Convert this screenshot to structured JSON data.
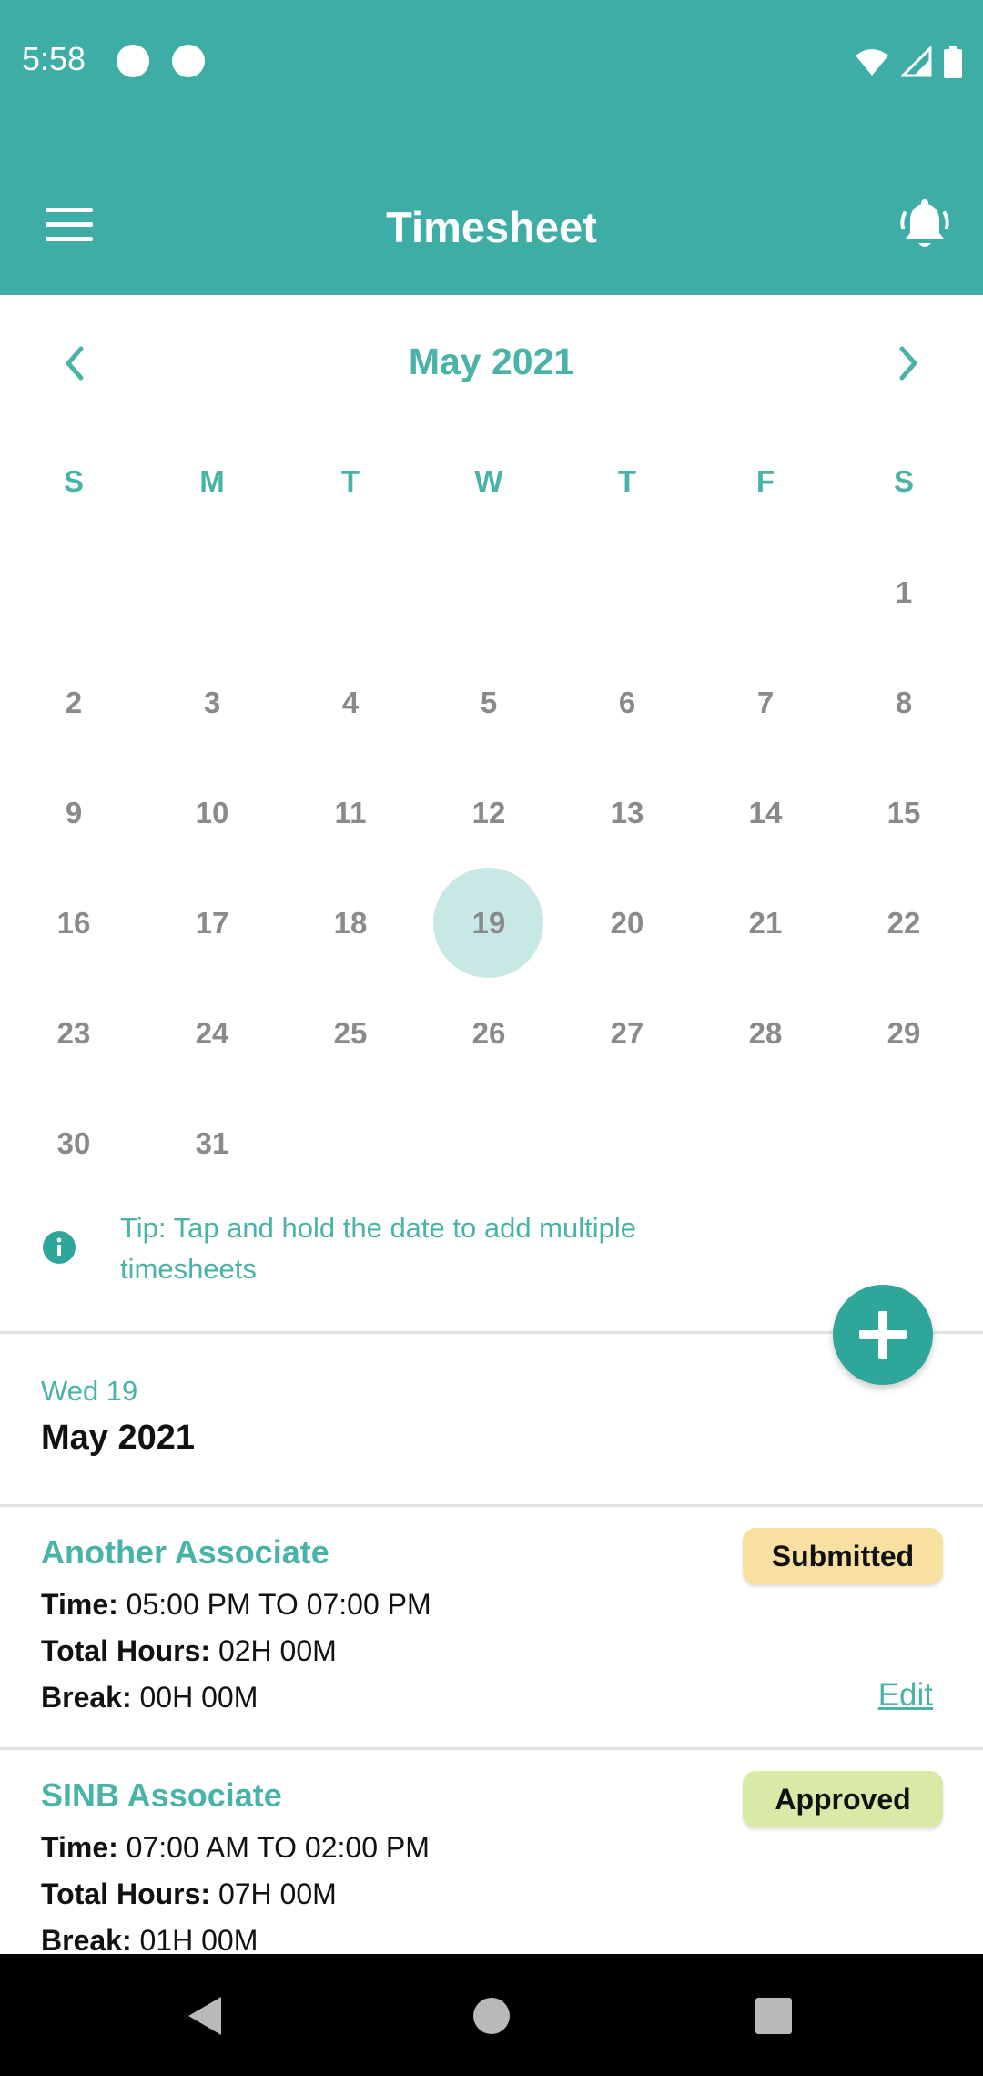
{
  "status_bar": {
    "time": "5:58",
    "icons": [
      "notification-dot-icon",
      "notification-dot-icon",
      "wifi-icon",
      "signal-icon",
      "battery-icon"
    ]
  },
  "app_bar": {
    "title": "Timesheet",
    "menu_icon": "hamburger-menu-icon",
    "bell_icon": "notification-bell-icon"
  },
  "calendar": {
    "month_label": "May 2021",
    "prev_icon": "chevron-left-icon",
    "next_icon": "chevron-right-icon",
    "weekdays": [
      "S",
      "M",
      "T",
      "W",
      "T",
      "F",
      "S"
    ],
    "days": [
      "1",
      "2",
      "3",
      "4",
      "5",
      "6",
      "7",
      "8",
      "9",
      "10",
      "11",
      "12",
      "13",
      "14",
      "15",
      "16",
      "17",
      "18",
      "19",
      "20",
      "21",
      "22",
      "23",
      "24",
      "25",
      "26",
      "27",
      "28",
      "29",
      "30",
      "31"
    ],
    "first_weekday_index": 6,
    "selected_day": "19"
  },
  "tip": {
    "icon": "info-icon",
    "text": "Tip: Tap and hold the date to add multiple timesheets"
  },
  "fab": {
    "icon": "plus-icon"
  },
  "selected_date": {
    "weekday_day": "Wed 19",
    "month_year": "May 2021"
  },
  "entries": [
    {
      "name": "Another Associate",
      "status": "Submitted",
      "status_color": "#f7e0a0",
      "time_label": "Time:",
      "time_value": "05:00 PM TO 07:00 PM",
      "hours_label": "Total Hours:",
      "hours_value": "02H 00M",
      "break_label": "Break:",
      "break_value": "00H 00M",
      "edit_label": "Edit"
    },
    {
      "name": "SINB Associate",
      "status": "Approved",
      "status_color": "#d9eaa6",
      "time_label": "Time:",
      "time_value": "07:00 AM TO 02:00 PM",
      "hours_label": "Total Hours:",
      "hours_value": "07H 00M",
      "break_label": "Break:",
      "break_value": "01H 00M"
    }
  ],
  "colors": {
    "primary": "#3dada5",
    "accent_text": "#4ab3a8",
    "selected_day_bg": "#c8e8e5",
    "fab": "#2fa69a"
  },
  "nav_bar": {
    "icons": [
      "back-triangle-icon",
      "home-circle-icon",
      "recents-square-icon"
    ]
  }
}
